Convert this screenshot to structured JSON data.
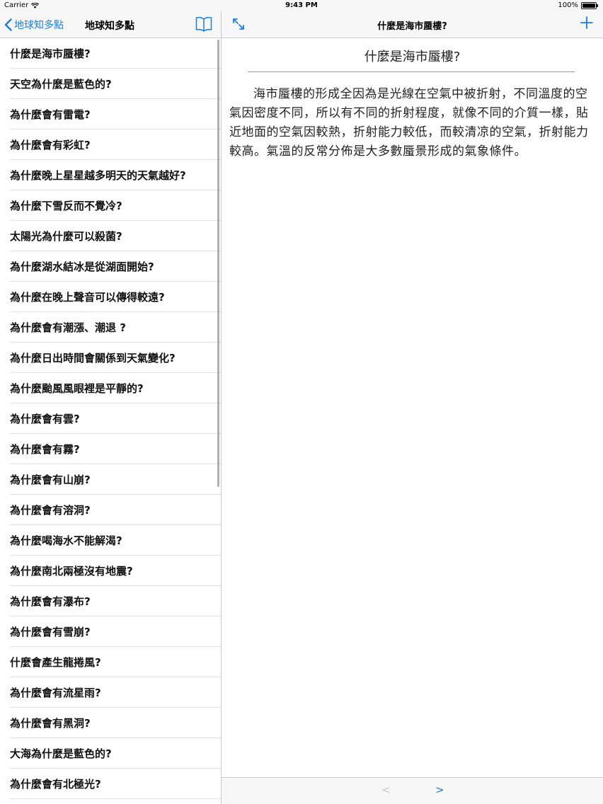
{
  "status_bar": {
    "carrier": "Carrier",
    "time": "9:43 PM",
    "battery": "100%"
  },
  "master": {
    "back_label": "地球知多點",
    "title": "地球知多點",
    "items": [
      "什麼是海市蜃樓?",
      "天空為什麼是藍色的?",
      "為什麼會有雷電?",
      "為什麼會有彩虹?",
      "為什麼晚上星星越多明天的天氣越好?",
      "為什麼下雪反而不覺冷?",
      "太陽光為什麼可以殺菌?",
      "為什麼湖水結冰是從湖面開始?",
      "為什麼在晚上聲音可以傳得較遠?",
      "為什麼會有潮漲、潮退 ?",
      "為什麼日出時間會關係到天氣變化?",
      "為什麼颱風風眼裡是平靜的?",
      "為什麼會有雲?",
      "為什麼會有霧?",
      "為什麼會有山崩?",
      "為什麼會有溶洞?",
      "為什麼喝海水不能解渴?",
      "為什麼南北兩極沒有地震?",
      "為什麼會有瀑布?",
      "為什麼會有雪崩?",
      "什麼會產生龍捲風?",
      "為什麼會有流星雨?",
      "為什麼會有黑洞?",
      "大海為什麼是藍色的?",
      "為什麼會有北極光?"
    ]
  },
  "detail": {
    "nav_title": "什麼是海市蜃樓?",
    "article_title": "什麼是海市蜃樓?",
    "body": "海市蜃樓的形成全因為是光線在空氣中被折射，不同溫度的空氣因密度不同，所以有不同的折射程度，就像不同的介質一樣，貼近地面的空氣因較熱，折射能力較低，而較清凉的空氣，折射能力較高。氣溫的反常分佈是大多數蜃景形成的氣象條件。",
    "prev_label": "<",
    "next_label": ">"
  },
  "colors": {
    "accent": "#1a7ee3",
    "bar_bg": "#f7f7f7",
    "separator": "#c8c7cc"
  }
}
